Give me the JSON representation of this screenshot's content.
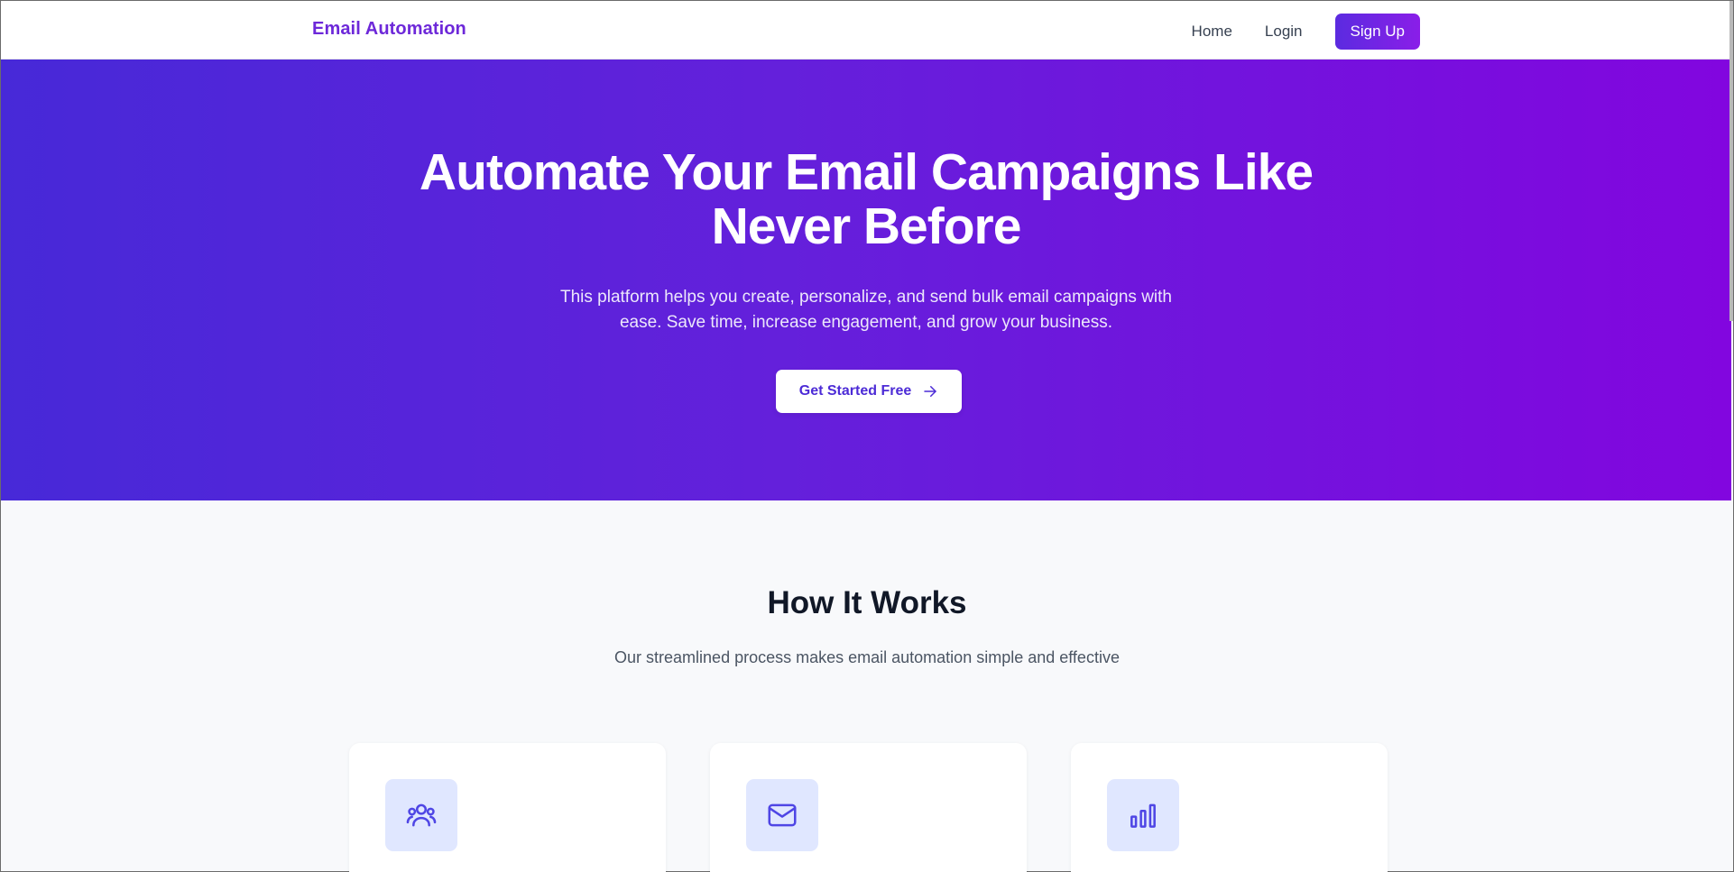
{
  "nav": {
    "brand": "Email Automation",
    "links": [
      "Home",
      "Login"
    ],
    "signup_label": "Sign Up"
  },
  "hero": {
    "title_line1": "Automate Your Email Campaigns Like",
    "title_line2": "Never Before",
    "subtitle_line1": "This platform helps you create, personalize, and send bulk email campaigns with",
    "subtitle_line2": "ease. Save time, increase engagement, and grow your business.",
    "cta_label": "Get Started Free"
  },
  "how": {
    "title": "How It Works",
    "subtitle": "Our streamlined process makes email automation simple and effective",
    "cards": [
      {
        "icon": "users-icon"
      },
      {
        "icon": "mail-icon"
      },
      {
        "icon": "bar-chart-icon"
      }
    ]
  },
  "colors": {
    "brand": "#6d28d9",
    "hero_start": "#4729d8",
    "hero_end": "#8206df",
    "icon": "#4f46e5",
    "icon_bg": "#e0e7ff"
  }
}
